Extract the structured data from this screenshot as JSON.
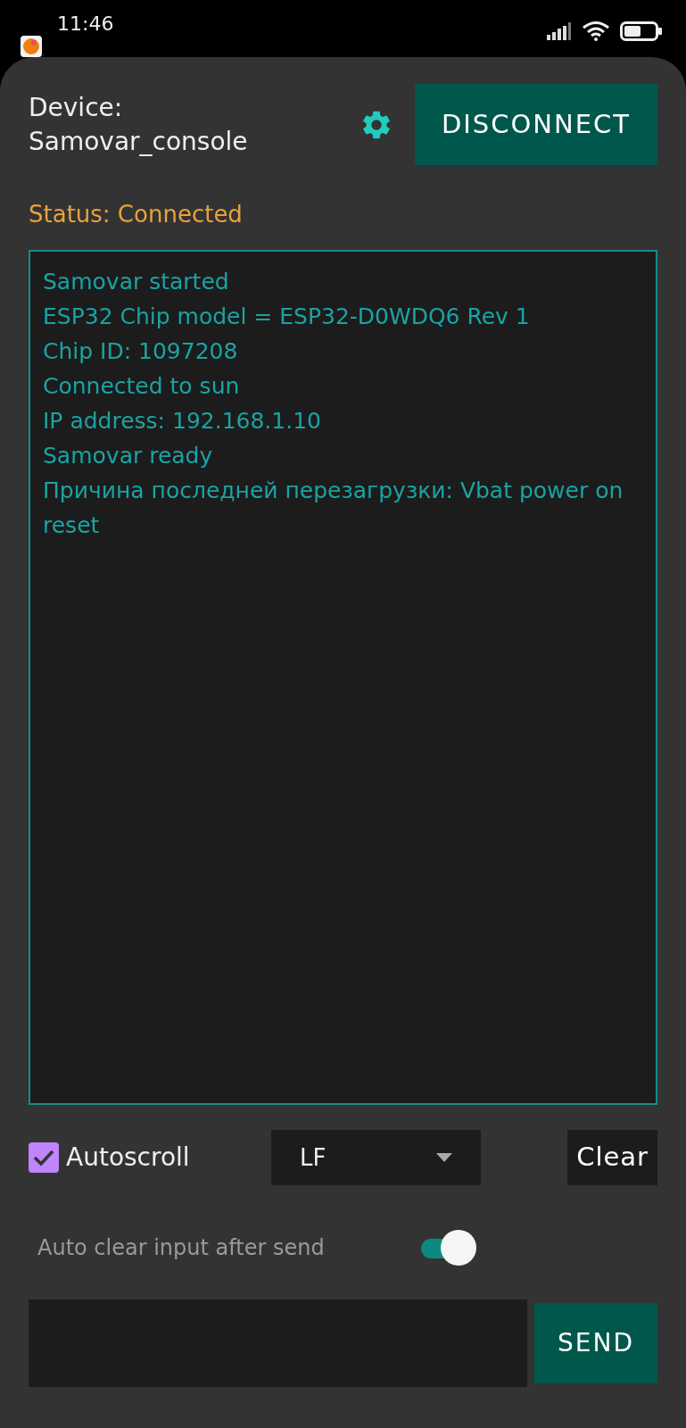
{
  "status_bar": {
    "time": "11:46"
  },
  "header": {
    "device_label": "Device:",
    "device_name": "Samovar_console",
    "disconnect_button": "DISCONNECT",
    "status": "Status: Connected"
  },
  "console": {
    "lines": [
      "Samovar started",
      "ESP32 Chip model = ESP32-D0WDQ6 Rev 1",
      "Chip ID: 1097208",
      "Connected to sun",
      "IP address: 192.168.1.10",
      "Samovar ready",
      "Причина последней перезагрузки: Vbat power on reset"
    ]
  },
  "controls": {
    "autoscroll": {
      "label": "Autoscroll",
      "checked": true
    },
    "line_ending": {
      "value": "LF"
    },
    "clear_button": "Clear"
  },
  "auto_clear": {
    "label": "Auto clear input after send",
    "on": true
  },
  "send_button": "SEND"
}
